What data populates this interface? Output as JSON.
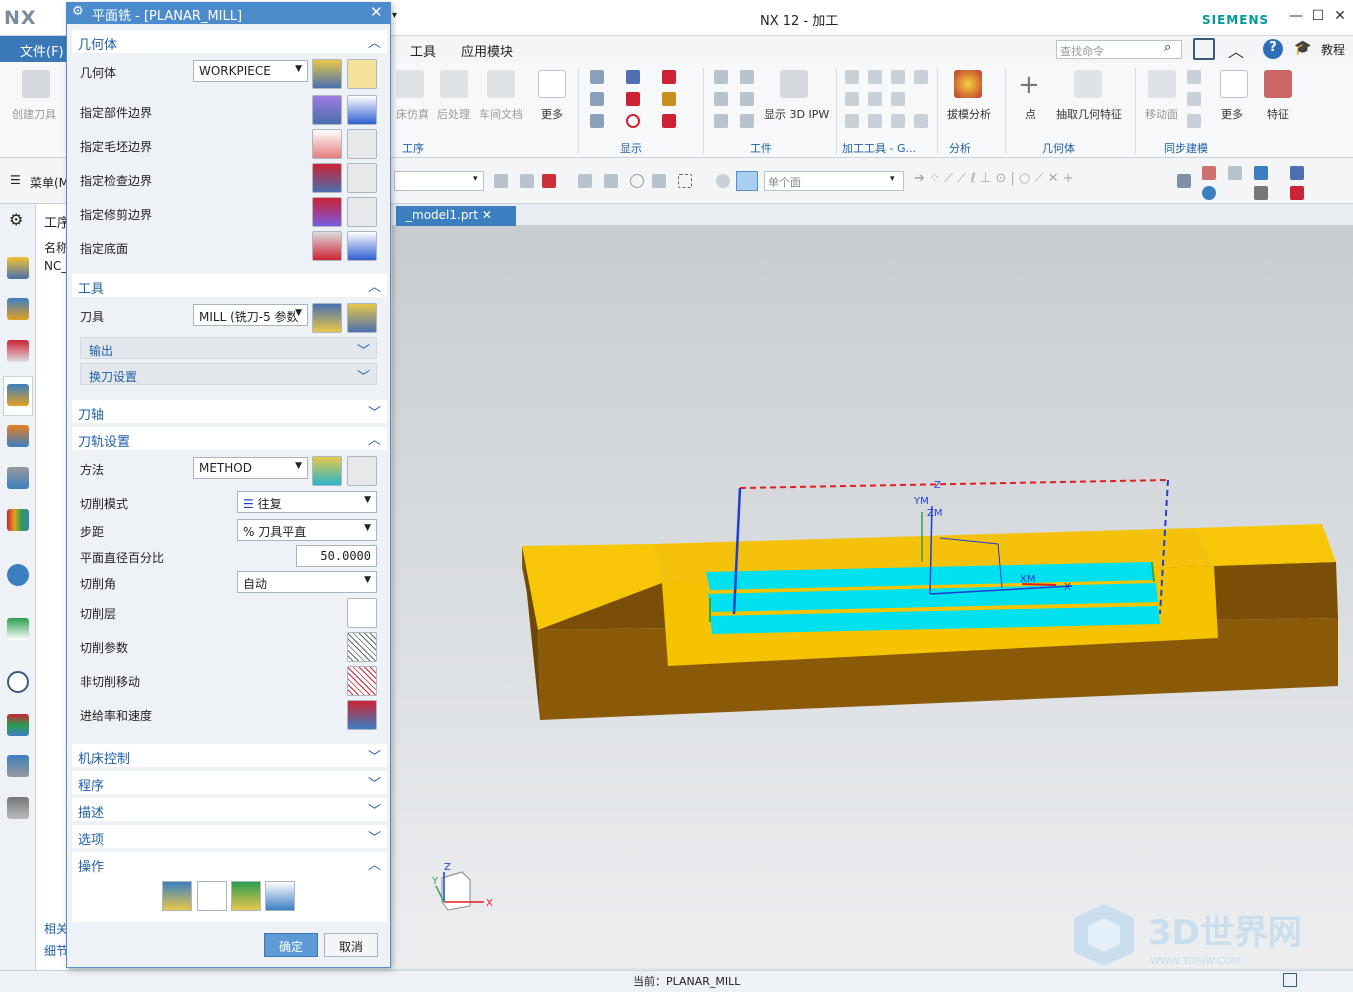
{
  "app": {
    "logo": "NX",
    "title": "NX 12 - 加工",
    "brand": "SIEMENS"
  },
  "menu": {
    "file": "文件(F)",
    "items": [
      "工具",
      "应用模块"
    ],
    "search_placeholder": "查找命令",
    "tutorial": "教程"
  },
  "ribbon": {
    "create_tool": "创建刀具",
    "machine_sim": "床仿真",
    "post": "后处理",
    "shop_doc": "车间文档",
    "more1": "更多",
    "show_ipw": "显示 3D IPW",
    "draft": "拔模分析",
    "point": "点",
    "extract": "抽取几何特征",
    "move_face": "移动面",
    "more2": "更多",
    "feature": "特征",
    "groups": [
      "工序",
      "显示",
      "工件",
      "加工工具 - G...",
      "分析",
      "几何体",
      "同步建模"
    ]
  },
  "toolbar2": {
    "menu": "菜单(M)",
    "filter_value": "",
    "scope": "单个面"
  },
  "navigator": {
    "title": "工序",
    "col_name": "名称",
    "root": "NC_",
    "bottom1": "相关",
    "bottom2": "细节"
  },
  "tab": {
    "label": "_model1.prt"
  },
  "dialog": {
    "title": "平面铣 - [PLANAR_MILL]",
    "geometry": {
      "header": "几何体",
      "geometry_label": "几何体",
      "geometry_value": "WORKPIECE",
      "part_boundary": "指定部件边界",
      "blank_boundary": "指定毛坯边界",
      "check_boundary": "指定检查边界",
      "trim_boundary": "指定修剪边界",
      "floor": "指定底面"
    },
    "tool": {
      "header": "工具",
      "tool_label": "刀具",
      "tool_value": "MILL (铣刀-5 参数",
      "output": "输出",
      "tool_change": "换刀设置"
    },
    "axis": {
      "header": "刀轴"
    },
    "path": {
      "header": "刀轨设置",
      "method_label": "方法",
      "method_value": "METHOD",
      "cut_pattern_label": "切削模式",
      "cut_pattern_value": "往复",
      "stepover_label": "步距",
      "stepover_value": "% 刀具平直",
      "percent_label": "平面直径百分比",
      "percent_value": "50.0000",
      "cut_angle_label": "切削角",
      "cut_angle_value": "自动",
      "cut_levels": "切削层",
      "cut_params": "切削参数",
      "non_cut": "非切削移动",
      "feeds": "进给率和速度"
    },
    "collapsed": [
      "机床控制",
      "程序",
      "描述",
      "选项"
    ],
    "actions_header": "操作",
    "ok": "确定",
    "cancel": "取消"
  },
  "viewport": {
    "label_x": "X",
    "label_y": "Y",
    "label_z": "Z",
    "label_xm": "XM",
    "label_ym": "YM",
    "label_zm": "ZM",
    "triad_x": "X",
    "triad_y": "Y",
    "triad_z": "Z"
  },
  "status": {
    "current": "当前：PLANAR_MILL"
  },
  "watermark": {
    "text": "3D世界网",
    "url": "WWW.3DSJW.COM"
  }
}
